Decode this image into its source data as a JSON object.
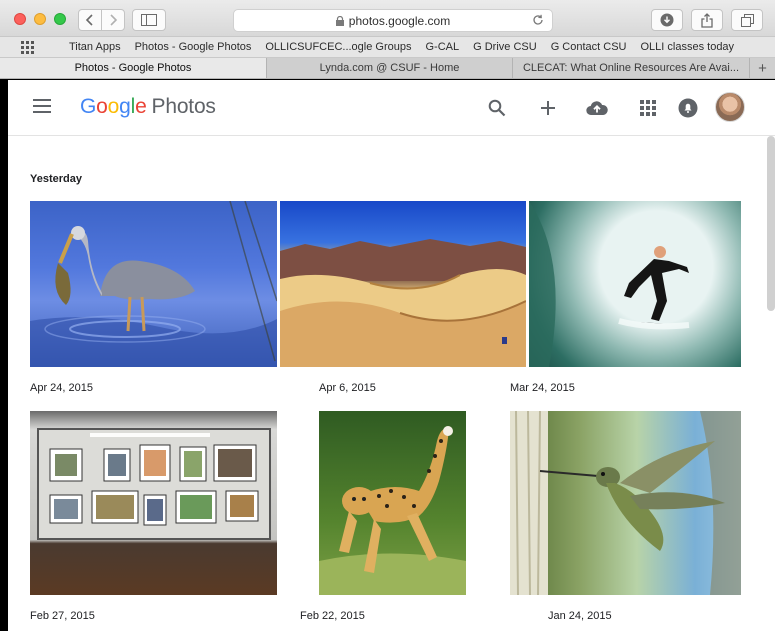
{
  "browser": {
    "url": "photos.google.com",
    "bookmarks": [
      "Titan Apps",
      "Photos - Google Photos",
      "OLLICSUFCEC...ogle Groups",
      "G-CAL",
      "G Drive CSU",
      "G Contact CSU",
      "OLLI classes today"
    ],
    "tabs": [
      {
        "label": "Photos - Google Photos",
        "active": true
      },
      {
        "label": "Lynda.com @ CSUF - Home",
        "active": false
      },
      {
        "label": "CLECAT: What Online Resources Are Avai...",
        "active": false
      }
    ],
    "new_tab_label": "+"
  },
  "app": {
    "logo": {
      "g1": "G",
      "g2": "o",
      "g3": "o",
      "g4": "g",
      "g5": "l",
      "g6": "e",
      "product": "Photos"
    },
    "icons": [
      "menu-icon",
      "search-icon",
      "add-icon",
      "cloud-upload-icon",
      "apps-grid-icon",
      "notifications-icon",
      "avatar"
    ]
  },
  "content": {
    "section_title": "Yesterday",
    "photos": [
      {
        "subject": "heron",
        "date": "Apr 24, 2015"
      },
      {
        "subject": "dunes",
        "date": "Apr 6, 2015"
      },
      {
        "subject": "surfer",
        "date": "Mar 24, 2015"
      },
      {
        "subject": "exhibit",
        "date": "Feb 27, 2015"
      },
      {
        "subject": "cheetah",
        "date": "Feb 22, 2015"
      },
      {
        "subject": "hummingbird",
        "date": "Jan 24, 2015"
      }
    ]
  },
  "colors": {
    "google_blue": "#4285f4",
    "google_red": "#ea4335",
    "google_yellow": "#fbbc05",
    "google_green": "#34a853",
    "icon_gray": "#5f6368"
  }
}
